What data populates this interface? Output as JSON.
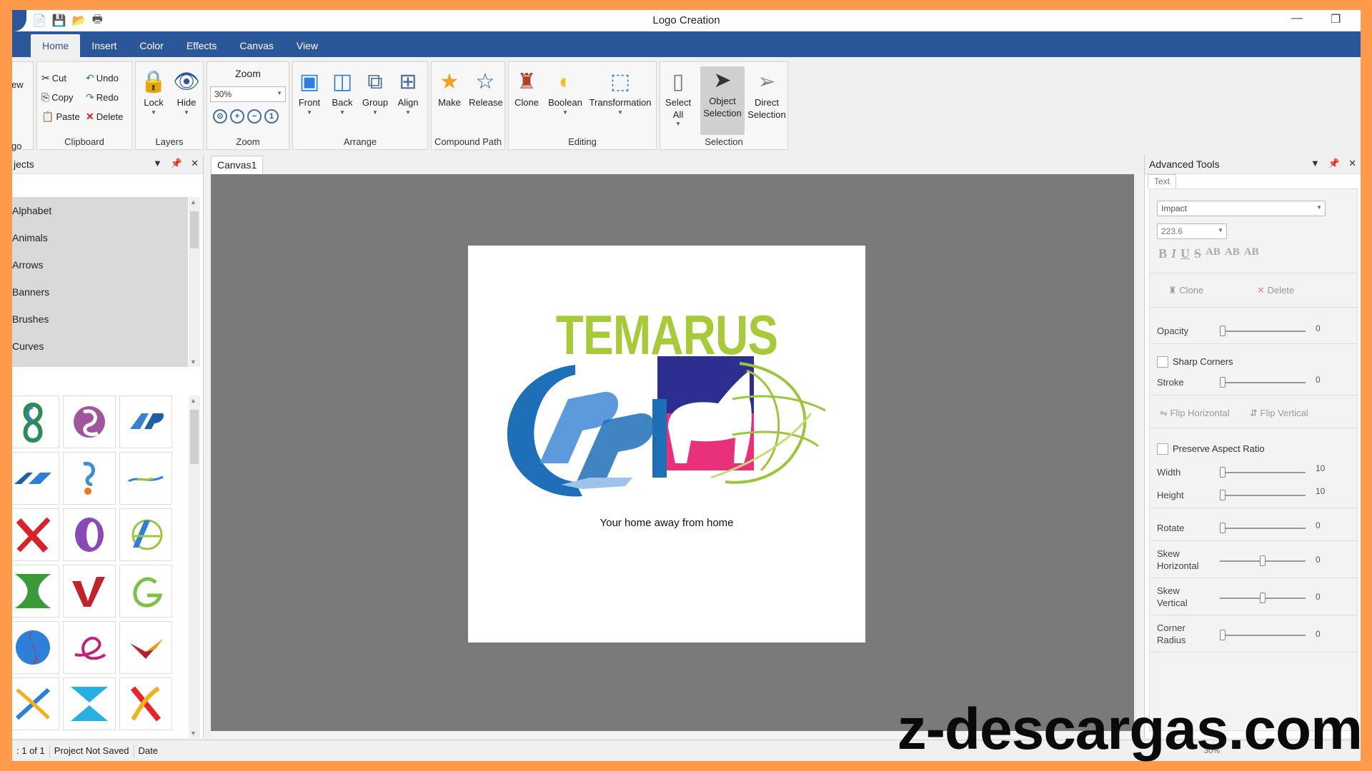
{
  "window": {
    "title": "Logo Creation"
  },
  "menu": {
    "tabs": [
      "Home",
      "Insert",
      "Color",
      "Effects",
      "Canvas",
      "View"
    ]
  },
  "ribbon": {
    "partial_left_top": "ew",
    "partial_left_bottom": "go",
    "clipboard": {
      "label": "Clipboard",
      "cut": "Cut",
      "copy": "Copy",
      "paste": "Paste",
      "undo": "Undo",
      "redo": "Redo",
      "delete": "Delete"
    },
    "layers": {
      "label": "Layers",
      "lock": "Lock",
      "hide": "Hide"
    },
    "zoom": {
      "label": "Zoom",
      "title": "Zoom",
      "value": "30%"
    },
    "arrange": {
      "label": "Arrange",
      "front": "Front",
      "back": "Back",
      "group": "Group",
      "align": "Align"
    },
    "compound": {
      "label": "Compound Path",
      "make": "Make",
      "release": "Release"
    },
    "editing": {
      "label": "Editing",
      "clone": "Clone",
      "boolean": "Boolean",
      "transformation": "Transformation"
    },
    "selection": {
      "label": "Selection",
      "select_all_1": "Select",
      "select_all_2": "All",
      "object_sel_1": "Object",
      "object_sel_2": "Selection",
      "direct_sel_1": "Direct",
      "direct_sel_2": "Selection"
    }
  },
  "left_panel": {
    "title": "jects",
    "categories": [
      "Alphabet",
      "Animals",
      "Arrows",
      "Banners",
      "Brushes",
      "Curves"
    ]
  },
  "document": {
    "tab": "Canvas1",
    "logo_title": "TEMARUS",
    "tagline": "Your home away from home"
  },
  "right_panel": {
    "title": "Advanced Tools",
    "tab": "Text",
    "font": "Impact",
    "font_size": "223.6",
    "fmt": [
      "B",
      "I",
      "U",
      "S",
      "AB",
      "AB",
      "AB"
    ],
    "clone": "Clone",
    "delete": "Delete",
    "opacity": {
      "label": "Opacity",
      "value": "0"
    },
    "sharp_corners": "Sharp Corners",
    "stroke": {
      "label": "Stroke",
      "value": "0"
    },
    "flip_h": "Flip Horizontal",
    "flip_v": "Flip Vertical",
    "preserve": "Preserve Aspect Ratio",
    "width": {
      "label": "Width",
      "value": "10"
    },
    "height": {
      "label": "Height",
      "value": "10"
    },
    "rotate": {
      "label": "Rotate",
      "value": "0"
    },
    "skew_h": {
      "label1": "Skew",
      "label2": "Horizontal",
      "value": "0",
      "level": 0.5
    },
    "skew_v": {
      "label1": "Skew",
      "label2": "Vertical",
      "value": "0",
      "level": 0.5
    },
    "corner": {
      "label1": "Corner",
      "label2": "Radius",
      "value": "0"
    }
  },
  "status": {
    "page": ": 1 of 1",
    "saved": "Project Not Saved",
    "date": "Date",
    "zoom": "30%"
  },
  "watermark": "z-descargas.com",
  "colors": {
    "accent": "#2b579a",
    "title_green": "#a8c93a",
    "logo_blue": "#1f6fb8",
    "logo_pink": "#e8317a",
    "logo_navy": "#2c2f8f",
    "page_border": "#ff9a4d"
  }
}
